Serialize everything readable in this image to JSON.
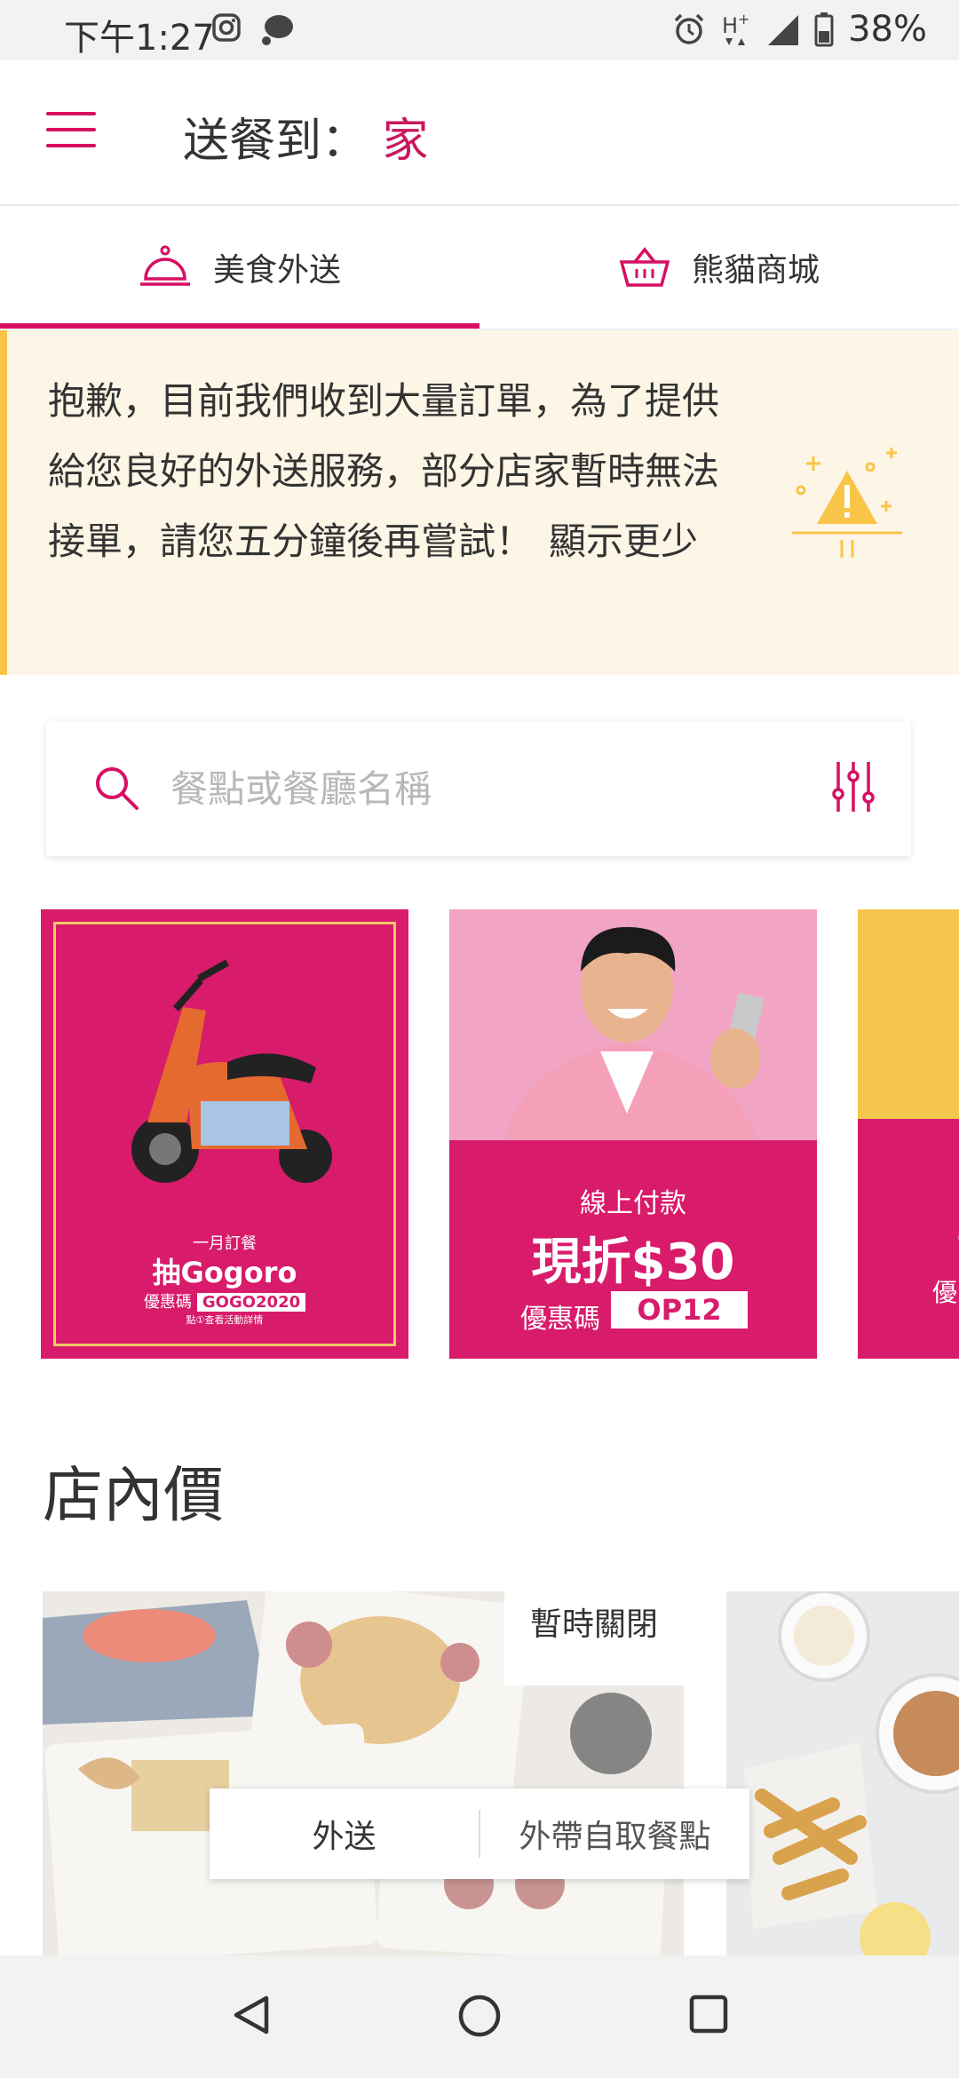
{
  "status_bar": {
    "time": "下午1:27",
    "battery": "38%",
    "icons": [
      "instagram-icon",
      "chat-bubble-icon",
      "alarm-icon",
      "hplus-signal-icon",
      "cell-signal-icon",
      "battery-icon"
    ]
  },
  "header": {
    "deliver_label": "送餐到：",
    "deliver_place": "家"
  },
  "tabs": [
    {
      "label": "美食外送",
      "icon": "food-cloche-icon",
      "active": true
    },
    {
      "label": "熊貓商城",
      "icon": "basket-icon",
      "active": false
    }
  ],
  "notice": {
    "message": "抱歉，目前我們收到大量訂單，為了提供給您良好的外送服務，部分店家暫時無法接單，請您五分鐘後再嘗試！",
    "toggle_label": "顯示更少",
    "icon": "warning-triangle-icon"
  },
  "search": {
    "placeholder": "餐點或餐廳名稱",
    "value": ""
  },
  "banners": [
    {
      "line1": "一月訂餐",
      "line2": "抽Gogoro",
      "code_label": "優惠碼",
      "code": "GOGO2020",
      "note": "點①查看活動詳情"
    },
    {
      "line1": "線上付款",
      "line2": "現折$30",
      "code_label": "優惠碼",
      "code": "OP12"
    },
    {
      "line1": "互",
      "line2": "優"
    }
  ],
  "section": {
    "title": "店內價"
  },
  "restaurant_card": {
    "closed_badge": "暫時關閉"
  },
  "delivery_toggle": {
    "options": [
      "外送",
      "外帶自取餐點"
    ]
  },
  "colors": {
    "brand": "#d70f64",
    "notice_bg": "#fdf5e6",
    "notice_accent": "#f9c548"
  }
}
